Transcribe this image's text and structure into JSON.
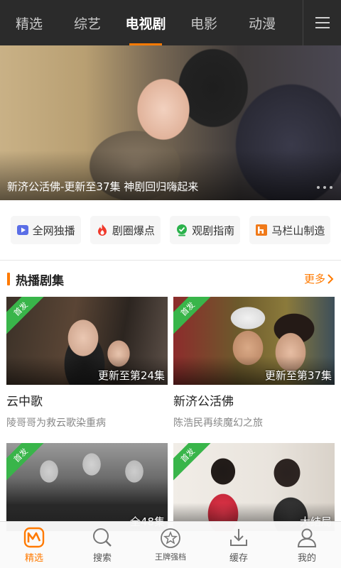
{
  "nav": {
    "tabs": [
      {
        "label": "精选",
        "active": false
      },
      {
        "label": "综艺",
        "active": false
      },
      {
        "label": "电视剧",
        "active": true
      },
      {
        "label": "电影",
        "active": false
      },
      {
        "label": "动漫",
        "active": false
      }
    ],
    "menu_icon": "hamburger-icon"
  },
  "banner": {
    "caption": "新济公活佛-更新至37集 神剧回归嗨起来"
  },
  "quick_links": [
    {
      "label": "全网独播",
      "icon": "play-icon",
      "color": "#5b6ee6"
    },
    {
      "label": "剧圈爆点",
      "icon": "flame-icon",
      "color": "#f0392b"
    },
    {
      "label": "观剧指南",
      "icon": "guide-icon",
      "color": "#2bb24c"
    },
    {
      "label": "马栏山制造",
      "icon": "mlshan-logo-icon",
      "color": "#f07a1a"
    }
  ],
  "section": {
    "title": "热播剧集",
    "more": "更多"
  },
  "cards": [
    {
      "badge": "首发",
      "episode": "更新至第24集",
      "title": "云中歌",
      "subtitle": "陵哥哥为救云歌染重病"
    },
    {
      "badge": "首发",
      "episode": "更新至第37集",
      "title": "新济公活佛",
      "subtitle": "陈浩民再续魔幻之旅"
    },
    {
      "badge": "首发",
      "episode": "全48集",
      "title": "",
      "subtitle": ""
    },
    {
      "badge": "首发",
      "episode": "大结局",
      "title": "",
      "subtitle": ""
    }
  ],
  "bottom_nav": [
    {
      "label": "精选",
      "icon": "mango-logo-icon",
      "active": true
    },
    {
      "label": "搜索",
      "icon": "search-icon",
      "active": false
    },
    {
      "label": "王牌强档",
      "icon": "star-icon",
      "active": false
    },
    {
      "label": "缓存",
      "icon": "download-icon",
      "active": false
    },
    {
      "label": "我的",
      "icon": "user-icon",
      "active": false
    }
  ],
  "colors": {
    "accent": "#ff7a00",
    "badge_green": "#39b54a",
    "nav_bg": "#2b2b2b"
  }
}
